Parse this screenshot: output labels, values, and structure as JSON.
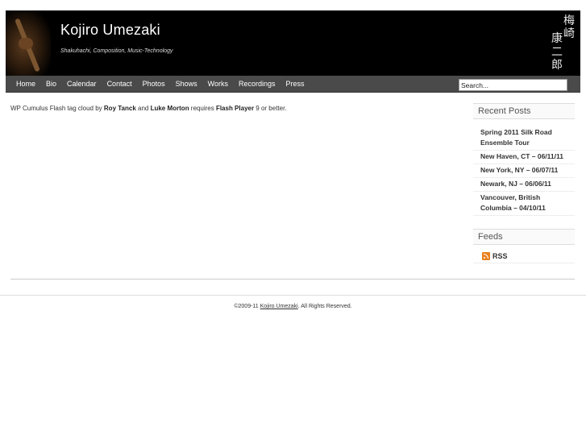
{
  "header": {
    "title": "Kojiro Umezaki",
    "tagline": "Shakuhachi, Composition, Music-Technology",
    "kanji": [
      "梅",
      "崎",
      "康",
      "二",
      "郎"
    ]
  },
  "nav": {
    "items": [
      "Home",
      "Bio",
      "Calendar",
      "Contact",
      "Photos",
      "Shows",
      "Works",
      "Recordings",
      "Press"
    ],
    "search_value": "Search..."
  },
  "main": {
    "text_1": "WP Cumulus Flash tag cloud by ",
    "roy": "Roy Tanck",
    "text_2": " and ",
    "luke": "Luke Morton",
    "text_3": " requires ",
    "flash": "Flash Player",
    "text_4": " 9 or better."
  },
  "sidebar": {
    "recent_title": "Recent Posts",
    "posts": [
      "Spring 2011 Silk Road Ensemble Tour",
      "New Haven, CT – 06/11/11",
      "New York, NY – 06/07/11",
      "Newark, NJ – 06/06/11",
      "Vancouver, British Columbia – 04/10/11"
    ],
    "feeds_title": "Feeds",
    "rss_label": "RSS"
  },
  "footer": {
    "prefix": "©2009-11 ",
    "link": "Kojiro Umezaki",
    "suffix": ". All Rights Reserved."
  },
  "colors": {
    "header_bg": "#000000",
    "nav_bg": "#4a4a4a",
    "rss_orange": "#e8801e"
  },
  "icons": {
    "rss": "rss-icon"
  }
}
